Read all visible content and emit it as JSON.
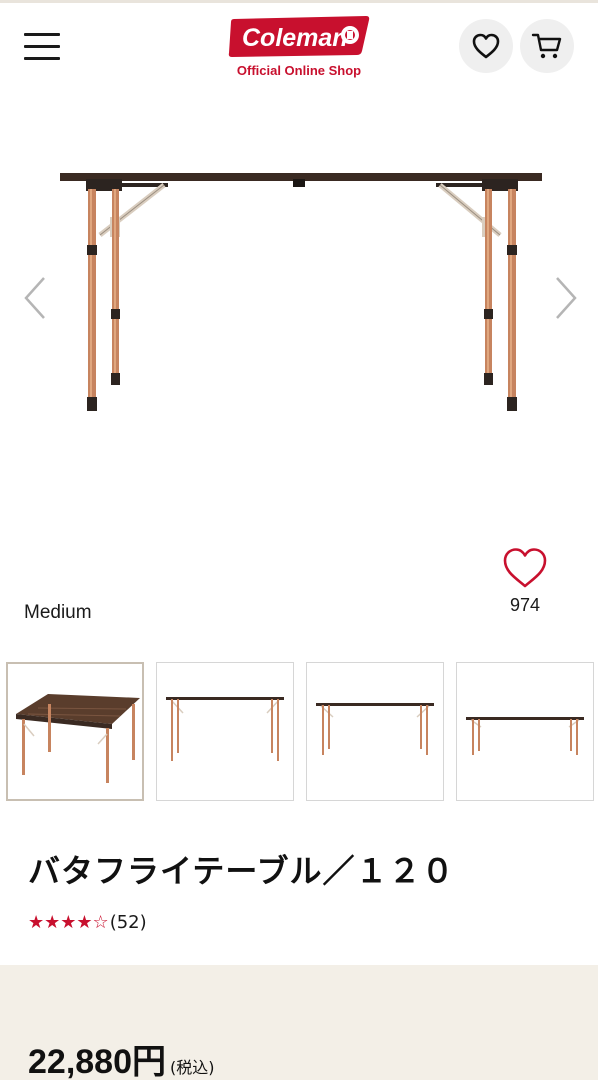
{
  "header": {
    "logo_text": "Coleman",
    "logo_subtitle": "Official Online Shop",
    "menu_icon": "hamburger-menu-icon",
    "favorites_icon": "heart-icon",
    "cart_icon": "cart-icon"
  },
  "gallery": {
    "prev_icon": "chevron-left-icon",
    "next_icon": "chevron-right-icon",
    "variant_label": "Medium",
    "like_count": "974",
    "thumbnail_count": 4,
    "active_thumbnail": 1
  },
  "product": {
    "title": "バタフライテーブル／１２０",
    "rating": 4,
    "rating_max": 5,
    "stars_text": "★★★★☆",
    "review_count": "(52)",
    "price": "22,880円",
    "tax_note": "(税込)"
  },
  "colors": {
    "brand_red": "#c8102e",
    "leg_copper": "#c7845f",
    "table_top": "#3a2a22",
    "price_band": "#f3efe7"
  }
}
